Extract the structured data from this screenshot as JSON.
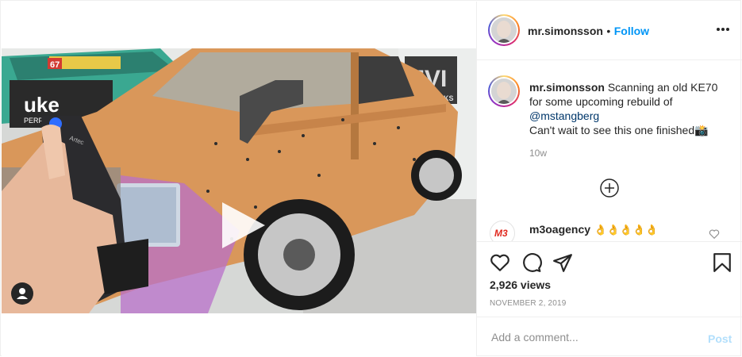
{
  "post": {
    "username": "mr.simonsson",
    "separator": "•",
    "follow_label": "Follow",
    "caption_line1": "Scanning an old KE70 for some upcoming rebuild of",
    "caption_mention": "@mstangberg",
    "caption_line2": "Can't wait to see this one finished",
    "caption_emoji": "📸",
    "time_ago": "10w",
    "views": "2,926 views",
    "date": "NOVEMBER 2, 2019"
  },
  "comments": [
    {
      "username": "m3oagency",
      "text": "👌👌👌👌👌",
      "avatar_text": "M3"
    }
  ],
  "add_comment": {
    "placeholder": "Add a comment...",
    "post_label": "Post"
  },
  "video_overlay": {
    "lens_brand": "Artec",
    "sign_letters": "EVI",
    "sign_text": "WORKS",
    "decal_number": "67",
    "decal_text": "uke",
    "decal_sub": "PERFORMANCE"
  },
  "icons": [
    "play-icon",
    "user-tag-icon",
    "more-options-icon",
    "load-more-comments-icon",
    "heart-icon",
    "comment-icon",
    "share-icon",
    "bookmark-icon",
    "comment-like-icon"
  ],
  "colors": {
    "accent": "#0095f6",
    "mention": "#00376b",
    "muted": "#8e8e8e",
    "post_disabled": "#b2dffc",
    "car_orange": "#d9975a"
  }
}
